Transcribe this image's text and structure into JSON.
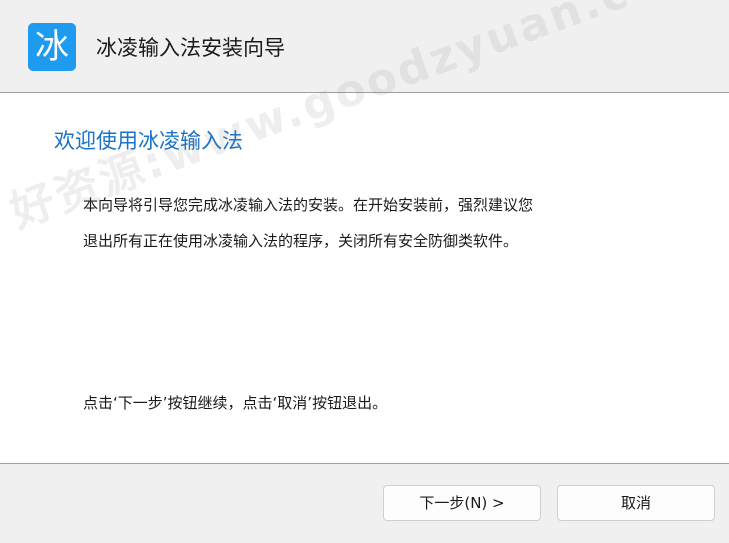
{
  "header": {
    "icon_glyph": "冰",
    "title": "冰凌输入法安装向导"
  },
  "main": {
    "welcome_title": "欢迎使用冰凌输入法",
    "description_line1": "本向导将引导您完成冰凌输入法的安装。在开始安装前，强烈建议您",
    "description_line2": "退出所有正在使用冰凌输入法的程序，关闭所有安全防御类软件。",
    "hint": "点击‘下一步’按钮继续，点击‘取消’按钮退出。",
    "watermark": "好资源:www.goodzyuan.com"
  },
  "footer": {
    "next_label": "下一步(N) >",
    "cancel_label": "取消"
  },
  "colors": {
    "accent": "#1a73c8",
    "icon_bg": "#1e9bf0"
  }
}
